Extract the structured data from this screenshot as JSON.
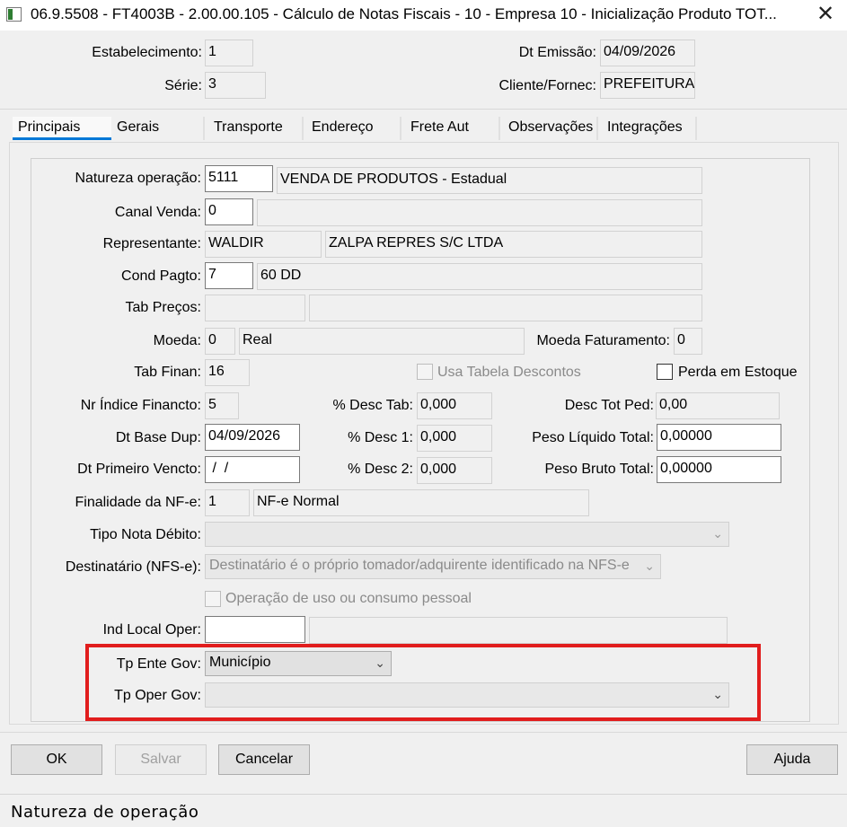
{
  "window": {
    "title": "06.9.5508 - FT4003B - 2.00.00.105 - Cálculo de Notas Fiscais - 10 - Empresa 10 - Inicialização Produto TOT...",
    "close_symbol": "✕"
  },
  "header": {
    "estabelecimento_label": "Estabelecimento:",
    "estabelecimento_value": "1",
    "serie_label": "Série:",
    "serie_value": "3",
    "dt_emissao_label": "Dt Emissão:",
    "dt_emissao_value": "04/09/2026",
    "cliente_label": "Cliente/Fornec:",
    "cliente_value": "PREFEITURA"
  },
  "tabs": [
    {
      "label": "Principais",
      "active": true
    },
    {
      "label": "Gerais"
    },
    {
      "label": "Transporte"
    },
    {
      "label": "Endereço"
    },
    {
      "label": "Frete Aut"
    },
    {
      "label": "Observações"
    },
    {
      "label": "Integrações"
    }
  ],
  "form": {
    "natureza_label": "Natureza operação:",
    "natureza_code": "5111",
    "natureza_desc": "VENDA DE PRODUTOS - Estadual",
    "canal_label": "Canal Venda:",
    "canal_code": "0",
    "canal_desc": "",
    "representante_label": "Representante:",
    "representante_code": "WALDIR",
    "representante_desc": "ZALPA REPRES S/C LTDA",
    "cond_label": "Cond Pagto:",
    "cond_code": "7",
    "cond_desc": "60 DD",
    "tab_precos_label": "Tab Preços:",
    "tab_precos_code": "",
    "tab_precos_desc": "",
    "moeda_label": "Moeda:",
    "moeda_code": "0",
    "moeda_desc": "Real",
    "moeda_fat_label": "Moeda Faturamento:",
    "moeda_fat_value": "0",
    "tab_finan_label": "Tab Finan:",
    "tab_finan_value": "16",
    "usa_tabela_label": "Usa Tabela Descontos",
    "perda_label": "Perda em Estoque",
    "nr_indice_label": "Nr Índice Financto:",
    "nr_indice_value": "5",
    "desc_tab_label": "% Desc Tab:",
    "desc_tab_value": "0,000",
    "desc_tot_label": "Desc Tot Ped:",
    "desc_tot_value": "0,00",
    "dt_base_label": "Dt Base Dup:",
    "dt_base_value": "04/09/2026",
    "desc1_label": "% Desc 1:",
    "desc1_value": "0,000",
    "peso_liq_label": "Peso Líquido Total:",
    "peso_liq_value": "0,00000",
    "dt_primeiro_label": "Dt Primeiro Vencto:",
    "dt_primeiro_value": " /  /",
    "desc2_label": "% Desc 2:",
    "desc2_value": "0,000",
    "peso_bruto_label": "Peso Bruto Total:",
    "peso_bruto_value": "0,00000",
    "finalidade_label": "Finalidade da NF-e:",
    "finalidade_code": "1",
    "finalidade_desc": "NF-e Normal",
    "tipo_nota_label": "Tipo Nota Débito:",
    "tipo_nota_value": "",
    "destinatario_label": "Destinatário (NFS-e):",
    "destinatario_value": "Destinatário é o próprio tomador/adquirente identificado na NFS-e",
    "operacao_uso_label": "Operação de uso ou consumo pessoal",
    "ind_local_label": "Ind Local Oper:",
    "ind_local_code": "",
    "ind_local_desc": "",
    "tp_ente_label": "Tp Ente Gov:",
    "tp_ente_value": "Município",
    "tp_oper_label": "Tp Oper Gov:",
    "tp_oper_value": ""
  },
  "buttons": {
    "ok": "OK",
    "salvar": "Salvar",
    "cancelar": "Cancelar",
    "ajuda": "Ajuda"
  },
  "status": {
    "text": "Natureza de operação"
  },
  "colors": {
    "highlight_box": "#e11d1d",
    "active_tab_underline": "#0078d7"
  }
}
